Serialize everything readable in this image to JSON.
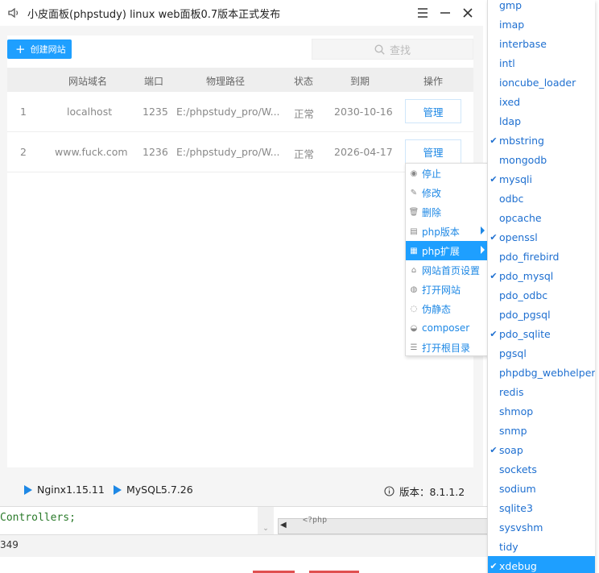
{
  "window": {
    "title": "小皮面板(phpstudy) linux web面板0.7版本正式发布"
  },
  "toolbar": {
    "create_label": "创建网站",
    "search_placeholder": "查找"
  },
  "table": {
    "headers": [
      "网站域名",
      "端口",
      "物理路径",
      "状态",
      "到期",
      "操作"
    ],
    "rows": [
      {
        "index": "1",
        "domain": "localhost",
        "port": "1235",
        "path": "E:/phpstudy_pro/W...",
        "status": "正常",
        "expiry": "2030-10-16",
        "action": "管理"
      },
      {
        "index": "2",
        "domain": "www.fuck.com",
        "port": "1236",
        "path": "E:/phpstudy_pro/W...",
        "status": "正常",
        "expiry": "2026-04-17",
        "action": "管理"
      }
    ]
  },
  "statusbar": {
    "nginx": "Nginx1.15.11",
    "mysql": "MySQL5.7.26",
    "version": "版本：8.1.1.2"
  },
  "editor": {
    "code_line": "Controllers;",
    "hscroll_text": "<?php",
    "line_number": "349"
  },
  "context_menu": {
    "items": [
      {
        "label": "停止",
        "icon": "stop-icon"
      },
      {
        "label": "修改",
        "icon": "edit-icon"
      },
      {
        "label": "删除",
        "icon": "trash-icon"
      },
      {
        "label": "php版本",
        "icon": "php-icon"
      },
      {
        "label": "php扩展",
        "icon": "extension-icon"
      },
      {
        "label": "网站首页设置",
        "icon": "home-icon"
      },
      {
        "label": "打开网站",
        "icon": "globe-icon"
      },
      {
        "label": "伪静态",
        "icon": "rewrite-icon"
      },
      {
        "label": "composer",
        "icon": "composer-icon"
      },
      {
        "label": "打开根目录",
        "icon": "folder-icon"
      }
    ],
    "active_index": 4
  },
  "extensions": {
    "items": [
      {
        "label": "gmp",
        "checked": false
      },
      {
        "label": "imap",
        "checked": false
      },
      {
        "label": "interbase",
        "checked": false
      },
      {
        "label": "intl",
        "checked": false
      },
      {
        "label": "ioncube_loader",
        "checked": false
      },
      {
        "label": "ixed",
        "checked": false
      },
      {
        "label": "ldap",
        "checked": false
      },
      {
        "label": "mbstring",
        "checked": true
      },
      {
        "label": "mongodb",
        "checked": false
      },
      {
        "label": "mysqli",
        "checked": true
      },
      {
        "label": "odbc",
        "checked": false
      },
      {
        "label": "opcache",
        "checked": false
      },
      {
        "label": "openssl",
        "checked": true
      },
      {
        "label": "pdo_firebird",
        "checked": false
      },
      {
        "label": "pdo_mysql",
        "checked": true
      },
      {
        "label": "pdo_odbc",
        "checked": false
      },
      {
        "label": "pdo_pgsql",
        "checked": false
      },
      {
        "label": "pdo_sqlite",
        "checked": true
      },
      {
        "label": "pgsql",
        "checked": false
      },
      {
        "label": "phpdbg_webhelper",
        "checked": false
      },
      {
        "label": "redis",
        "checked": false
      },
      {
        "label": "shmop",
        "checked": false
      },
      {
        "label": "snmp",
        "checked": false
      },
      {
        "label": "soap",
        "checked": true
      },
      {
        "label": "sockets",
        "checked": false
      },
      {
        "label": "sodium",
        "checked": false
      },
      {
        "label": "sqlite3",
        "checked": false
      },
      {
        "label": "sysvshm",
        "checked": false
      },
      {
        "label": "tidy",
        "checked": false
      },
      {
        "label": "xdebug",
        "checked": true
      }
    ],
    "active_index": 29,
    "check_glyph": "✔"
  },
  "colors": {
    "accent": "#1e9fff",
    "link": "#1e88e5",
    "code_green": "#2a7a2a"
  }
}
